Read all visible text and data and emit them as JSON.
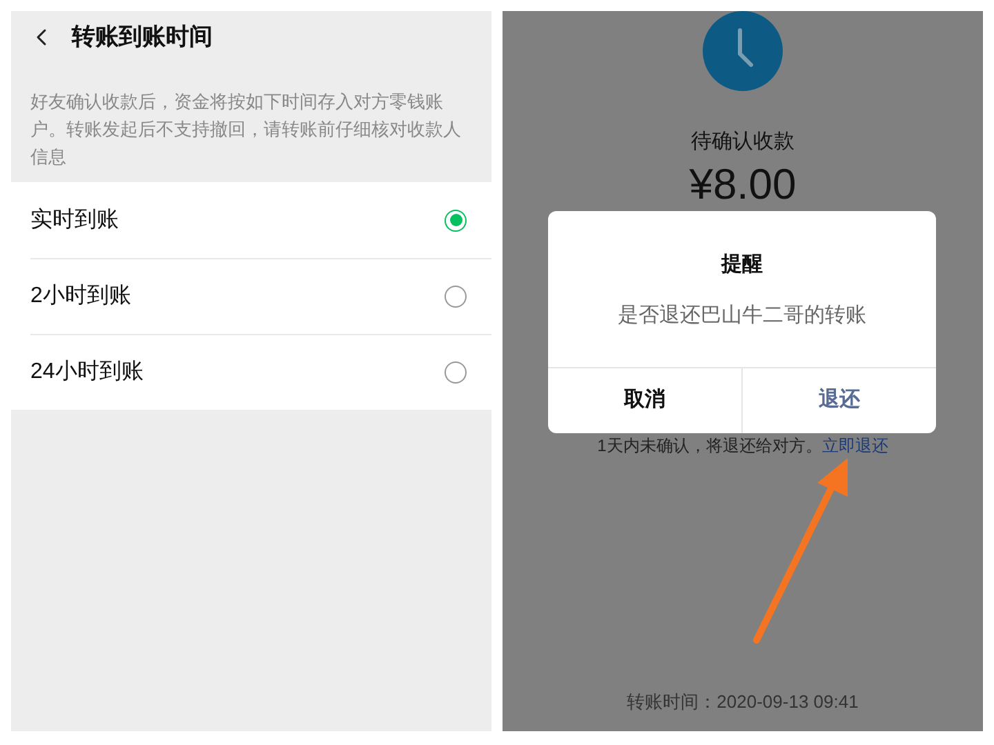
{
  "settings": {
    "title": "转账到账时间",
    "description": "好友确认收款后，资金将按如下时间存入对方零钱账户。转账发起后不支持撤回，请转账前仔细核对收款人信息",
    "options": [
      {
        "label": "实时到账",
        "selected": true
      },
      {
        "label": "2小时到账",
        "selected": false
      },
      {
        "label": "24小时到账",
        "selected": false
      }
    ]
  },
  "transfer": {
    "status": "待确认收款",
    "amount": "¥8.00",
    "notice": "1天内未确认，将退还给对方。",
    "notice_link": "立即退还",
    "transfer_time": "转账时间：2020-09-13 09:41",
    "dialog": {
      "title": "提醒",
      "message": "是否退还巴山牛二哥的转账",
      "buttons": [
        {
          "label": "取消",
          "kind": "cancel"
        },
        {
          "label": "退还",
          "kind": "confirm"
        }
      ]
    }
  }
}
